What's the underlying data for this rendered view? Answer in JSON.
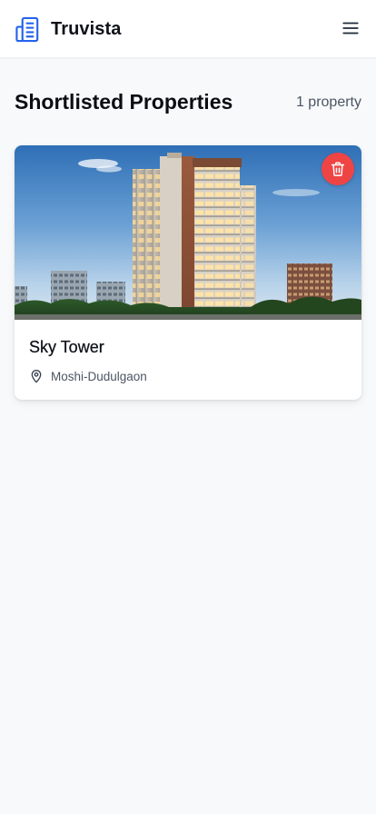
{
  "header": {
    "brand_name": "Truvista",
    "brand_icon": "building-icon",
    "menu_icon": "hamburger-menu-icon"
  },
  "page": {
    "title": "Shortlisted Properties",
    "count_text": "1 property"
  },
  "properties": [
    {
      "name": "Sky Tower",
      "location": "Moshi-Dudulgaon",
      "location_icon": "map-pin-icon",
      "remove_icon": "trash-icon",
      "photo": "tower-photo"
    }
  ],
  "colors": {
    "brand": "#2563eb",
    "danger": "#ef4444",
    "background": "#f8f9fb"
  }
}
